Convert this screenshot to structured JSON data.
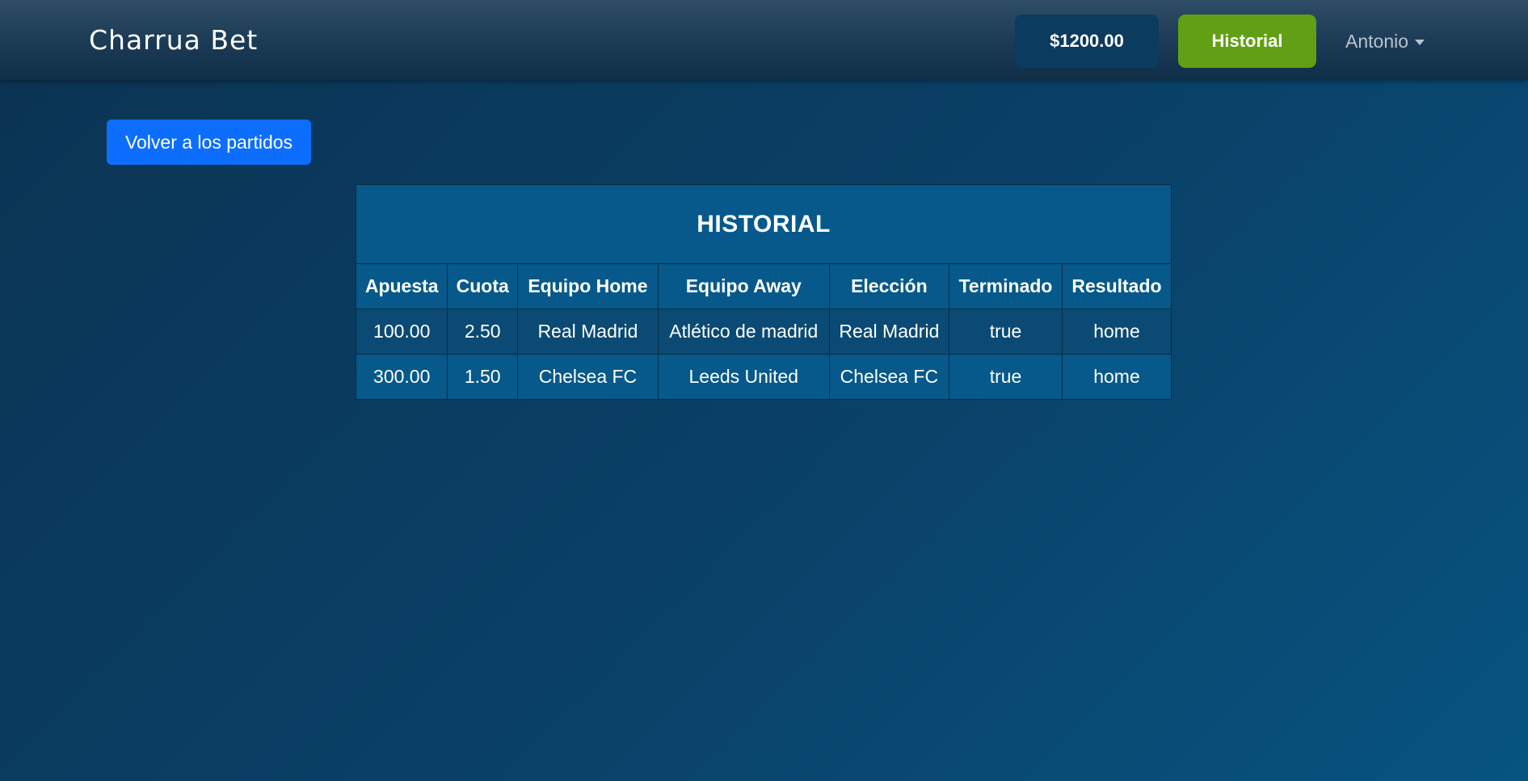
{
  "navbar": {
    "brand": "Charrua Bet",
    "balance": "$1200.00",
    "historial_label": "Historial",
    "user_name": "Antonio"
  },
  "main": {
    "back_button_label": "Volver a los partidos",
    "table": {
      "title": "HISTORIAL",
      "headers": [
        "Apuesta",
        "Cuota",
        "Equipo Home",
        "Equipo Away",
        "Elección",
        "Terminado",
        "Resultado"
      ],
      "rows": [
        [
          "100.00",
          "2.50",
          "Real Madrid",
          "Atlético de madrid",
          "Real Madrid",
          "true",
          "home"
        ],
        [
          "300.00",
          "1.50",
          "Chelsea FC",
          "Leeds United",
          "Chelsea FC",
          "true",
          "home"
        ]
      ]
    }
  },
  "colors": {
    "balance_bg": "#0b3b5e",
    "historial_bg": "#61a014",
    "back_button_bg": "#0d6efd",
    "table_bg": "#06598a"
  }
}
